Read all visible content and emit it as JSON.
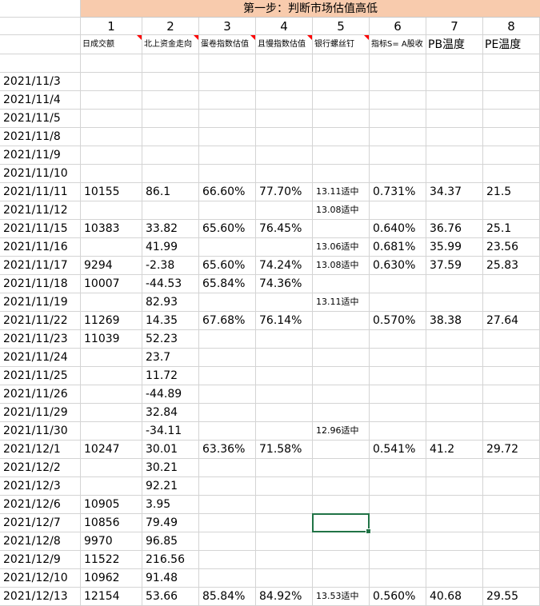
{
  "banner_title": "第一步：判断市场估值高低",
  "column_numbers": [
    "1",
    "2",
    "3",
    "4",
    "5",
    "6",
    "7",
    "8"
  ],
  "column_headers": [
    "日成交额",
    "北上资金走向",
    "蛋卷指数估值",
    "且慢指数估值",
    "银行螺丝钉",
    "指标S= A股收",
    "PB温度",
    "PE温度"
  ],
  "rows": [
    [
      "2021/11/3",
      "",
      "",
      "",
      "",
      "",
      "",
      "",
      ""
    ],
    [
      "2021/11/4",
      "",
      "",
      "",
      "",
      "",
      "",
      "",
      ""
    ],
    [
      "2021/11/5",
      "",
      "",
      "",
      "",
      "",
      "",
      "",
      ""
    ],
    [
      "2021/11/8",
      "",
      "",
      "",
      "",
      "",
      "",
      "",
      ""
    ],
    [
      "2021/11/9",
      "",
      "",
      "",
      "",
      "",
      "",
      "",
      ""
    ],
    [
      "2021/11/10",
      "",
      "",
      "",
      "",
      "",
      "",
      "",
      ""
    ],
    [
      "2021/11/11",
      "10155",
      "86.1",
      "66.60%",
      "77.70%",
      "13.11适中",
      "0.731%",
      "34.37",
      "21.5"
    ],
    [
      "2021/11/12",
      "",
      "",
      "",
      "",
      "13.08适中",
      "",
      "",
      ""
    ],
    [
      "2021/11/15",
      "10383",
      "33.82",
      "65.60%",
      "76.45%",
      "",
      "0.640%",
      "36.76",
      "25.1"
    ],
    [
      "2021/11/16",
      "",
      "41.99",
      "",
      "",
      "13.06适中",
      "0.681%",
      "35.99",
      "23.56"
    ],
    [
      "2021/11/17",
      "9294",
      "-2.38",
      "65.60%",
      "74.24%",
      "13.08适中",
      "0.630%",
      "37.59",
      "25.83"
    ],
    [
      "2021/11/18",
      "10007",
      "-44.53",
      "65.84%",
      "74.36%",
      "",
      "",
      "",
      ""
    ],
    [
      "2021/11/19",
      "",
      "82.93",
      "",
      "",
      "13.11适中",
      "",
      "",
      ""
    ],
    [
      "2021/11/22",
      "11269",
      "14.35",
      "67.68%",
      "76.14%",
      "",
      "0.570%",
      "38.38",
      "27.64"
    ],
    [
      "2021/11/23",
      "11039",
      "52.23",
      "",
      "",
      "",
      "",
      "",
      ""
    ],
    [
      "2021/11/24",
      "",
      "23.7",
      "",
      "",
      "",
      "",
      "",
      ""
    ],
    [
      "2021/11/25",
      "",
      "11.72",
      "",
      "",
      "",
      "",
      "",
      ""
    ],
    [
      "2021/11/26",
      "",
      "-44.89",
      "",
      "",
      "",
      "",
      "",
      ""
    ],
    [
      "2021/11/29",
      "",
      "32.84",
      "",
      "",
      "",
      "",
      "",
      ""
    ],
    [
      "2021/11/30",
      "",
      "-34.11",
      "",
      "",
      "12.96适中",
      "",
      "",
      ""
    ],
    [
      "2021/12/1",
      "10247",
      "30.01",
      "63.36%",
      "71.58%",
      "",
      "0.541%",
      "41.2",
      "29.72"
    ],
    [
      "2021/12/2",
      "",
      "30.21",
      "",
      "",
      "",
      "",
      "",
      ""
    ],
    [
      "2021/12/3",
      "",
      "92.21",
      "",
      "",
      "",
      "",
      "",
      ""
    ],
    [
      "2021/12/6",
      "10905",
      "3.95",
      "",
      "",
      "",
      "",
      "",
      ""
    ],
    [
      "2021/12/7",
      "10856",
      "79.49",
      "",
      "",
      "",
      "",
      "",
      ""
    ],
    [
      "2021/12/8",
      "9970",
      "96.85",
      "",
      "",
      "",
      "",
      "",
      ""
    ],
    [
      "2021/12/9",
      "11522",
      "216.56",
      "",
      "",
      "",
      "",
      "",
      ""
    ],
    [
      "2021/12/10",
      "10962",
      "91.48",
      "",
      "",
      "",
      "",
      "",
      ""
    ],
    [
      "2021/12/13",
      "12154",
      "53.66",
      "85.84%",
      "84.92%",
      "13.53适中",
      "0.560%",
      "40.68",
      "29.55"
    ]
  ],
  "comment_flag_columns": [
    1,
    2,
    3,
    4,
    5
  ],
  "selected_cell": {
    "row": 24,
    "col": 5
  },
  "colors": {
    "banner_bg": "#f8cbad",
    "gridline": "#d4d4d4",
    "selection": "#217346",
    "comment_flag": "#ff0000"
  }
}
